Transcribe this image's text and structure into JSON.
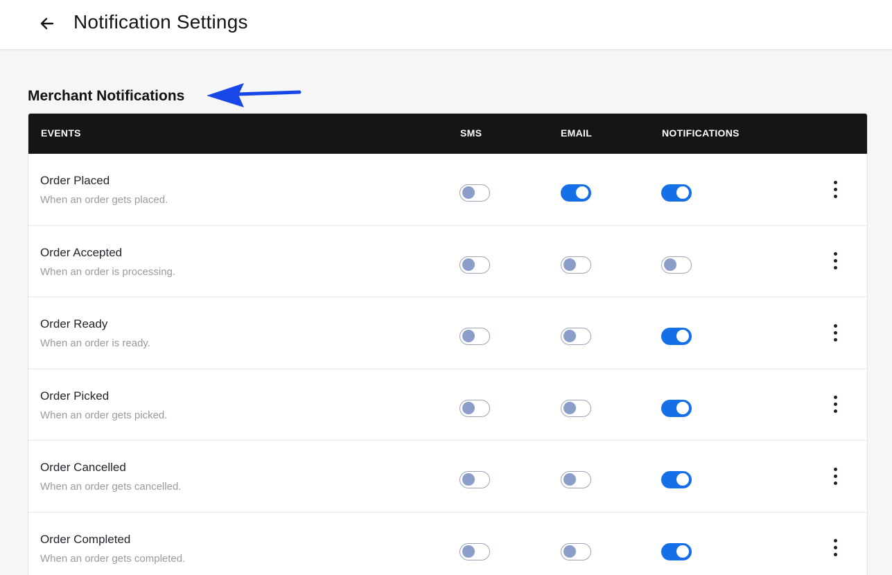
{
  "header": {
    "title": "Notification Settings"
  },
  "section": {
    "title": "Merchant Notifications"
  },
  "table": {
    "columns": {
      "events": "EVENTS",
      "sms": "SMS",
      "email": "EMAIL",
      "notifications": "NOTIFICATIONS"
    },
    "rows": [
      {
        "name": "Order Placed",
        "description": "When an order gets placed.",
        "sms": false,
        "email": true,
        "notifications": true
      },
      {
        "name": "Order Accepted",
        "description": "When an order is processing.",
        "sms": false,
        "email": false,
        "notifications": false
      },
      {
        "name": "Order Ready",
        "description": "When an order is ready.",
        "sms": false,
        "email": false,
        "notifications": true
      },
      {
        "name": "Order Picked",
        "description": "When an order gets picked.",
        "sms": false,
        "email": false,
        "notifications": true
      },
      {
        "name": "Order Cancelled",
        "description": "When an order gets cancelled.",
        "sms": false,
        "email": false,
        "notifications": true
      },
      {
        "name": "Order Completed",
        "description": "When an order gets completed.",
        "sms": false,
        "email": false,
        "notifications": true
      }
    ]
  },
  "colors": {
    "toggle_on": "#1570e8",
    "toggle_off_knob": "#8a9ec9",
    "header_bg": "#151515",
    "annotation_arrow": "#1747e6"
  },
  "icons": {
    "back": "arrow-left-icon",
    "row_menu": "kebab-menu-icon",
    "annotation": "annotation-arrow-icon"
  }
}
